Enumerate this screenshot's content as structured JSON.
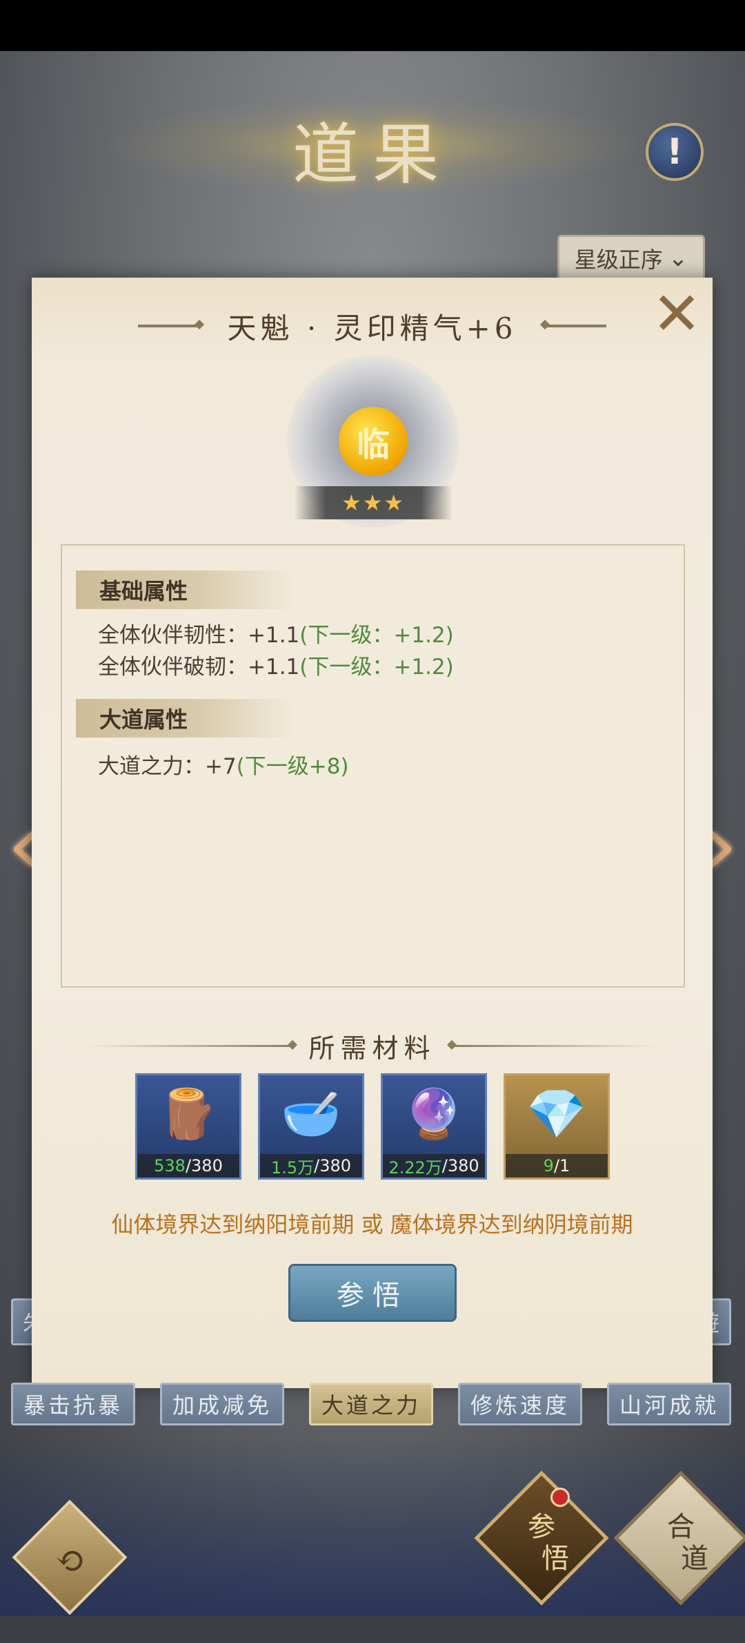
{
  "header": {
    "title": "道果",
    "info_icon": "!"
  },
  "sort": {
    "label": "星级正序",
    "chevron": "⌄"
  },
  "panel": {
    "title": "天魁 · 灵印精气+6",
    "close": "✕",
    "medal_char": "临",
    "stars": "★★★",
    "basic_attr": {
      "heading": "基础属性",
      "lines": [
        {
          "label": "全体伙伴韧性：+1.1",
          "next": "(下一级：+1.2)"
        },
        {
          "label": "全体伙伴破韧：+1.1",
          "next": "(下一级：+1.2)"
        }
      ]
    },
    "dao_attr": {
      "heading": "大道属性",
      "lines": [
        {
          "label": "大道之力：+7",
          "next": "(下一级+8)"
        }
      ]
    },
    "materials": {
      "heading": "所需材料",
      "items": [
        {
          "icon": "scroll-icon",
          "glyph": "🪵",
          "have": "538",
          "need": "/380"
        },
        {
          "icon": "bowl-icon",
          "glyph": "🥣",
          "have": "1.5万",
          "need": "/380"
        },
        {
          "icon": "ore-icon",
          "glyph": "🔮",
          "have": "2.22万",
          "need": "/380"
        },
        {
          "icon": "crystal-icon",
          "glyph": "💎",
          "have": "9",
          "need": "/1"
        }
      ]
    },
    "requirement": "仙体境界达到纳阳境前期 或 魔体境界达到纳阴境前期",
    "action_button": "参悟"
  },
  "nav": {
    "prev": "‹",
    "next": "›"
  },
  "tabs_row2_partial": {
    "left": "朱",
    "right": "遊"
  },
  "tabs": [
    "暴击抗暴",
    "加成减免",
    "大道之力",
    "修炼速度",
    "山河成就"
  ],
  "active_tab_index": 2,
  "bottom": {
    "left_button_glyph": "⟲",
    "comprehend_top": "参",
    "comprehend_bottom": "悟",
    "merge_top": "合",
    "merge_bottom": "道"
  }
}
